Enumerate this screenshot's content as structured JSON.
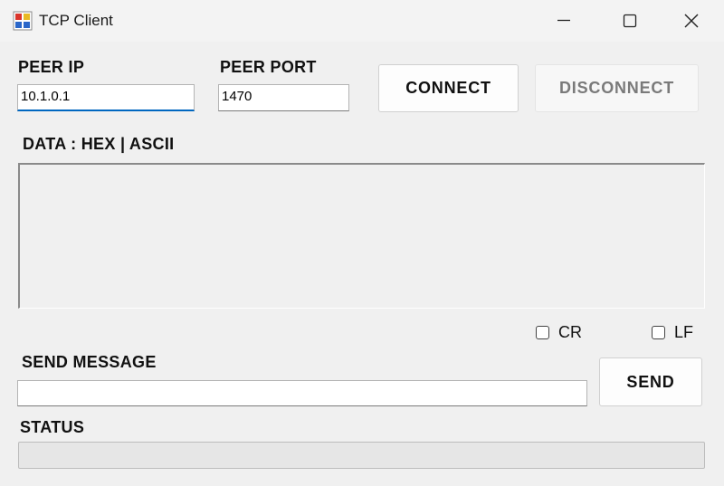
{
  "window": {
    "title": "TCP Client"
  },
  "connection": {
    "peer_ip_label": "PEER IP",
    "peer_ip_value": "10.1.0.1",
    "peer_port_label": "PEER PORT",
    "peer_port_value": "1470",
    "connect_label": "CONNECT",
    "disconnect_label": "DISCONNECT"
  },
  "data": {
    "label": "DATA : HEX | ASCII"
  },
  "options": {
    "cr_label": "CR",
    "cr_checked": false,
    "lf_label": "LF",
    "lf_checked": false
  },
  "send": {
    "label": "SEND MESSAGE",
    "value": "",
    "button_label": "SEND"
  },
  "status": {
    "label": "STATUS",
    "text": ""
  },
  "icons": {
    "app": "app-icon",
    "minimize": "minimize-icon",
    "maximize": "maximize-icon",
    "close": "close-icon"
  }
}
